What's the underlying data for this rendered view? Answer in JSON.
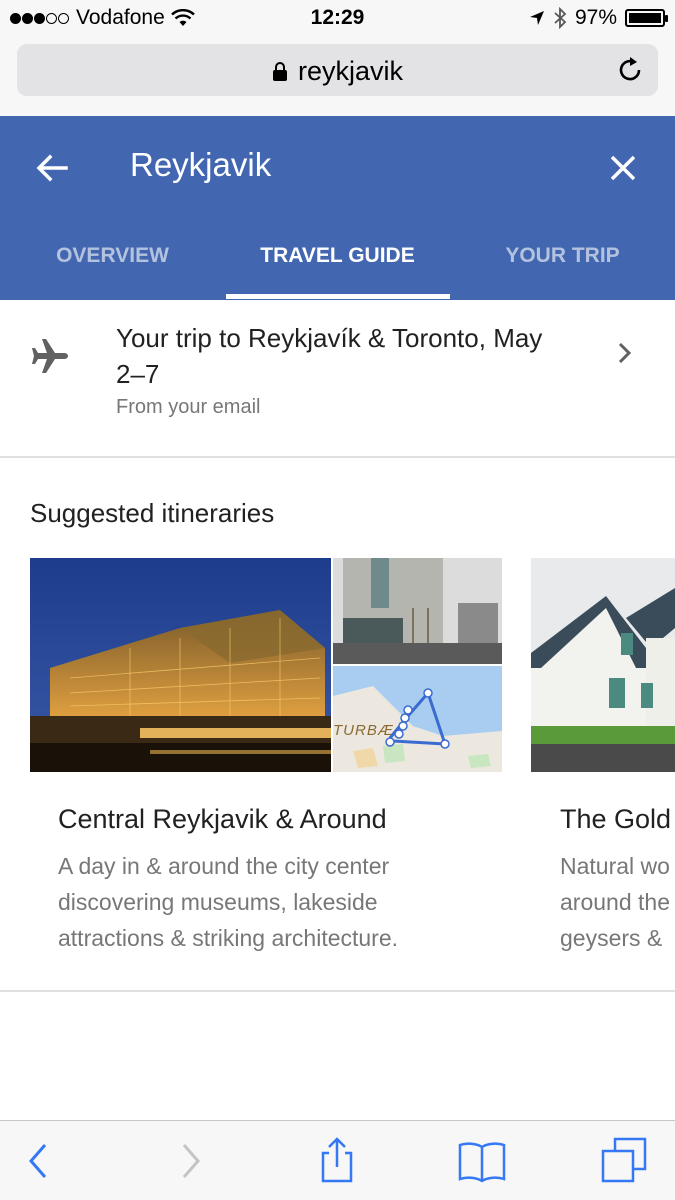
{
  "status_bar": {
    "carrier": "Vodafone",
    "time": "12:29",
    "battery": "97%",
    "signal_icon": "signal-dots-icon",
    "wifi_icon": "wifi-icon",
    "location_icon": "location-arrow-icon",
    "bluetooth_icon": "bluetooth-icon",
    "battery_icon": "battery-icon"
  },
  "address_bar": {
    "url": "reykjavik",
    "lock_icon": "lock-icon",
    "reload_icon": "reload-icon"
  },
  "header": {
    "title": "Reykjavik",
    "back_icon": "back-arrow-icon",
    "close_icon": "close-icon",
    "tabs": [
      {
        "label": "OVERVIEW",
        "active": false
      },
      {
        "label": "TRAVEL GUIDE",
        "active": true
      },
      {
        "label": "YOUR TRIP",
        "active": false
      }
    ],
    "color": "#4267b0"
  },
  "trip": {
    "title": "Your trip to Reykjavík & Toronto, May 2–7",
    "subtitle": "From your email",
    "icon": "airplane-icon"
  },
  "itineraries": {
    "heading": "Suggested itineraries",
    "cards": [
      {
        "title": "Central Reykjavik & Around",
        "description": "A day in & around the city center discovering museums, lakeside attractions & striking architecture.",
        "map_label": "TURBÆ"
      },
      {
        "title": "The Gold",
        "description": "Natural wo around the geysers &"
      }
    ]
  },
  "toolbar": {
    "back_icon": "chevron-left-icon",
    "forward_icon": "chevron-right-icon",
    "share_icon": "share-icon",
    "bookmarks_icon": "bookmarks-icon",
    "tabs_icon": "tabs-icon"
  }
}
